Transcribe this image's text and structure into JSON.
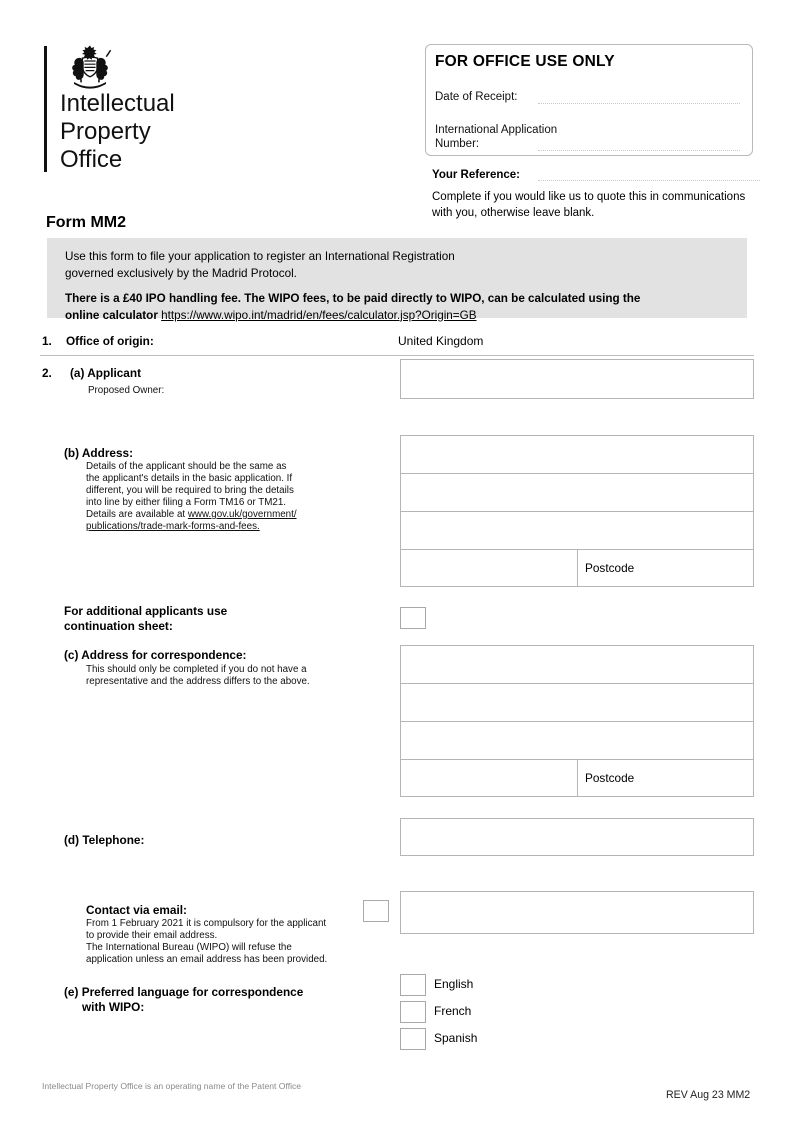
{
  "logo": {
    "crest_icon": "royal-coat-of-arms-icon",
    "line1": "Intellectual",
    "line2": "Property",
    "line3": "Office"
  },
  "office_use": {
    "title": "FOR OFFICE USE ONLY",
    "date_of_receipt_label": "Date of Receipt:",
    "international_application_label_1": "International Application",
    "international_application_label_2": "Number:"
  },
  "your_reference": {
    "label": "Your Reference:",
    "note": "Complete if you would like us to quote this in communications with you, otherwise leave blank."
  },
  "form": {
    "title": "Form MM2"
  },
  "banner": {
    "paragraph1_line1": "Use this form to file your application to register an International Registration",
    "paragraph1_line2": "governed exclusively by the Madrid Protocol.",
    "paragraph2_line1": "There is a £40 IPO handling fee. The WIPO fees, to be paid directly to WIPO, can be calculated using the",
    "paragraph2_line2_prefix": "online calculator ",
    "paragraph2_link": "https://www.wipo.int/madrid/en/fees/calculator.jsp?Origin=GB"
  },
  "sections": {
    "s1": {
      "number": "1.",
      "label": "Office of origin:",
      "value": "United Kingdom"
    },
    "s2": {
      "number": "2.",
      "a": {
        "label": "(a) Applicant",
        "sub_label": "Proposed Owner:"
      },
      "b": {
        "label": "(b) Address:",
        "note_line1": "Details of the applicant should be the same as",
        "note_line2": "the applicant's details in the basic application.  If",
        "note_line3": "different, you will be required to bring the details",
        "note_line4": "into line by either filing a Form TM16 or TM21.",
        "note_line5_prefix": "Details are available at ",
        "note_link_line1": "www.gov.uk/government/",
        "note_link_line2": "publications/trade-mark-forms-and-fees.",
        "postcode_label": "Postcode"
      },
      "continuation": {
        "label_line1": "For additional applicants use",
        "label_line2": "continuation sheet:"
      },
      "c": {
        "label": "(c) Address for correspondence:",
        "note_line1": "This should only be completed if you do not have a",
        "note_line2": "representative and the address differs to the above.",
        "postcode_label": "Postcode"
      },
      "d": {
        "label": "(d) Telephone:"
      },
      "email": {
        "label": "Contact via email:",
        "note_line1": "From 1 February 2021 it is compulsory for the applicant",
        "note_line2": "to provide their email address.",
        "note_line3": "The International Bureau (WIPO) will refuse the",
        "note_line4": "application unless an email address has been provided."
      },
      "e": {
        "label_line1": "(e) Preferred language for correspondence",
        "label_line2": "with WIPO:",
        "options": [
          {
            "label": "English"
          },
          {
            "label": "French"
          },
          {
            "label": "Spanish"
          }
        ]
      }
    }
  },
  "footer": {
    "left": "Intellectual Property Office is an operating name of the Patent Office",
    "right": "REV Aug 23 MM2"
  },
  "colors": {
    "banner_background": "#e2e2e2",
    "box_border": "#b5b5b5",
    "dotted_line": "#c9c9c9",
    "footer_text": "#8a8a8a"
  }
}
